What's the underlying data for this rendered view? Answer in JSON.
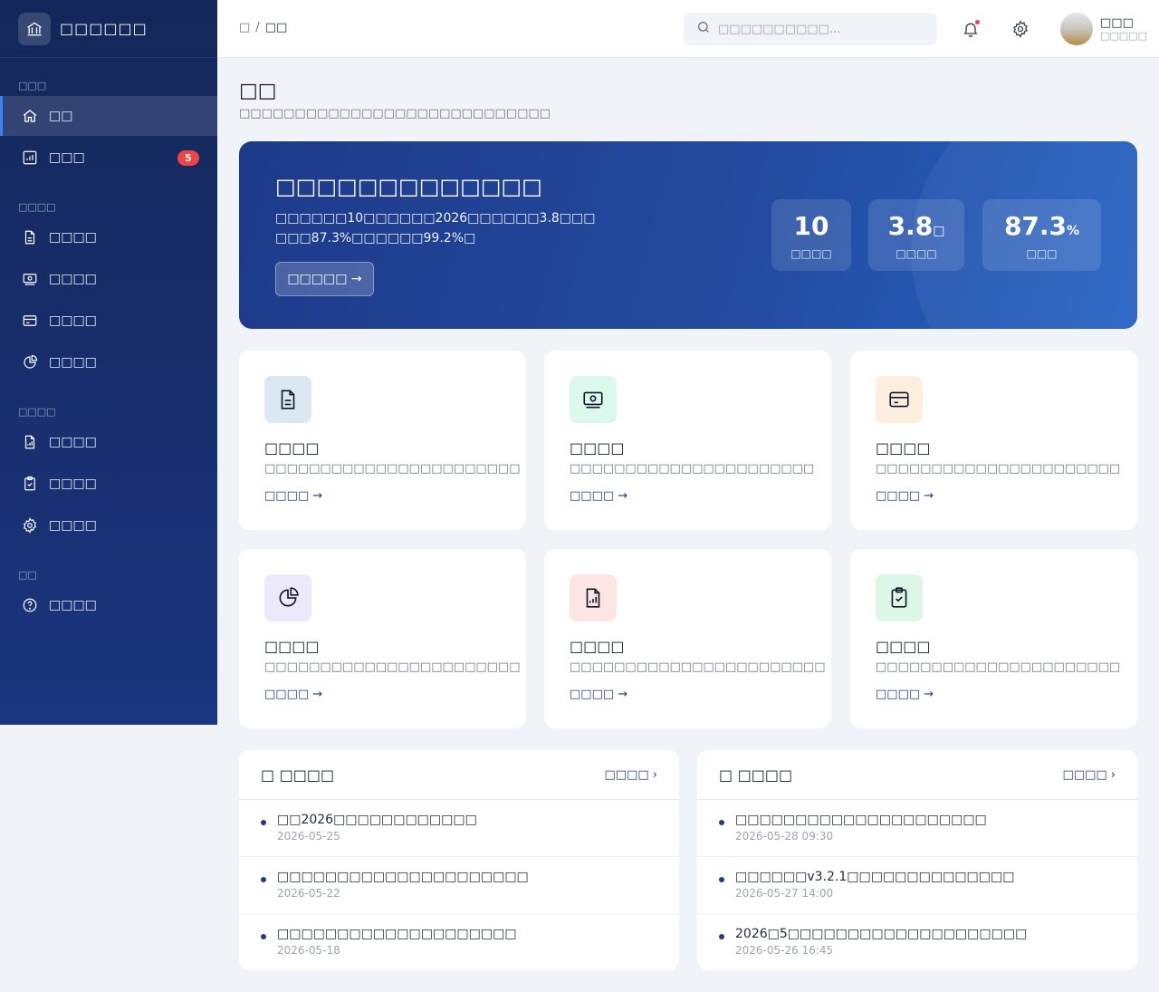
{
  "sidebar": {
    "brand": "□□□□□□",
    "sections": [
      "□□□",
      "□□□□",
      "□□□□",
      "□□"
    ],
    "items": [
      {
        "label": "□□",
        "icon": "home-icon"
      },
      {
        "label": "□□□",
        "icon": "bar-chart-icon",
        "badge": "5"
      },
      {
        "label": "□□□□",
        "icon": "document-icon"
      },
      {
        "label": "□□□□",
        "icon": "banknote-icon"
      },
      {
        "label": "□□□□",
        "icon": "credit-card-icon"
      },
      {
        "label": "□□□□",
        "icon": "pie-chart-icon"
      },
      {
        "label": "□□□□",
        "icon": "report-file-icon"
      },
      {
        "label": "□□□□",
        "icon": "clipboard-check-icon"
      },
      {
        "label": "□□□□",
        "icon": "gear-icon"
      },
      {
        "label": "□□□□",
        "icon": "help-icon"
      }
    ]
  },
  "header": {
    "breadcrumb_home": "□",
    "breadcrumb_sep": "/",
    "breadcrumb_current": "□□",
    "search_placeholder": "□□□□□□□□□□...",
    "user_name": "□□□",
    "user_role": "□□□□□"
  },
  "page": {
    "title": "□□",
    "subtitle": "□□□□□□□□□□□□□□□□□□□□□□□□□□□□"
  },
  "hero": {
    "title": "□□□□□□□□□□□□□",
    "desc_line1": "□□□□□□10□□□□□□2026□□□□□□3.8□□□",
    "desc_line2": "□□□87.3%□□□□□□99.2%□",
    "button": "□□□□□ →",
    "stats": [
      {
        "value": "10",
        "unit": "",
        "label": "□□□□"
      },
      {
        "value": "3.8",
        "unit": "□",
        "label": "□□□□"
      },
      {
        "value": "87.3",
        "unit": "%",
        "label": "□□□"
      }
    ]
  },
  "cards": [
    {
      "title": "□□□□",
      "desc": "□□□□□□□□□□□□□□□□□□□□□□□",
      "link": "□□□□ →",
      "icon": "document-icon",
      "color": "#dbe7f3"
    },
    {
      "title": "□□□□",
      "desc": "□□□□□□□□□□□□□□□□□□□□□□",
      "link": "□□□□ →",
      "icon": "banknote-icon",
      "color": "#dcf7ec"
    },
    {
      "title": "□□□□",
      "desc": "□□□□□□□□□□□□□□□□□□□□□□",
      "link": "□□□□ →",
      "icon": "credit-card-icon",
      "color": "#fdeedd"
    },
    {
      "title": "□□□□",
      "desc": "□□□□□□□□□□□□□□□□□□□□□□□",
      "link": "□□□□ →",
      "icon": "pie-chart-icon",
      "color": "#ece9fb"
    },
    {
      "title": "□□□□",
      "desc": "□□□□□□□□□□□□□□□□□□□□□□□",
      "link": "□□□□ →",
      "icon": "report-file-icon",
      "color": "#fde5e5"
    },
    {
      "title": "□□□□",
      "desc": "□□□□□□□□□□□□□□□□□□□□□□",
      "link": "□□□□ →",
      "icon": "clipboard-check-icon",
      "color": "#dcf7e7"
    }
  ],
  "panels": [
    {
      "title": "□ □□□□",
      "more": "□□□□ ›",
      "items": [
        {
          "title": "□□2026□□□□□□□□□□□□",
          "date": "2026-05-25"
        },
        {
          "title": "□□□□□□□□□□□□□□□□□□□□□",
          "date": "2026-05-22"
        },
        {
          "title": "□□□□□□□□□□□□□□□□□□□□",
          "date": "2026-05-18"
        }
      ]
    },
    {
      "title": "□ □□□□",
      "more": "□□□□ ›",
      "items": [
        {
          "title": "□□□□□□□□□□□□□□□□□□□□□",
          "date": "2026-05-28 09:30"
        },
        {
          "title": "□□□□□□v3.2.1□□□□□□□□□□□□□□",
          "date": "2026-05-27 14:00"
        },
        {
          "title": "2026□5□□□□□□□□□□□□□□□□□□□□",
          "date": "2026-05-26 16:45"
        }
      ]
    }
  ],
  "colors": {
    "accent": "#1e3a8a",
    "sidebar_bg": "#14275a",
    "badge": "#ef4444"
  }
}
